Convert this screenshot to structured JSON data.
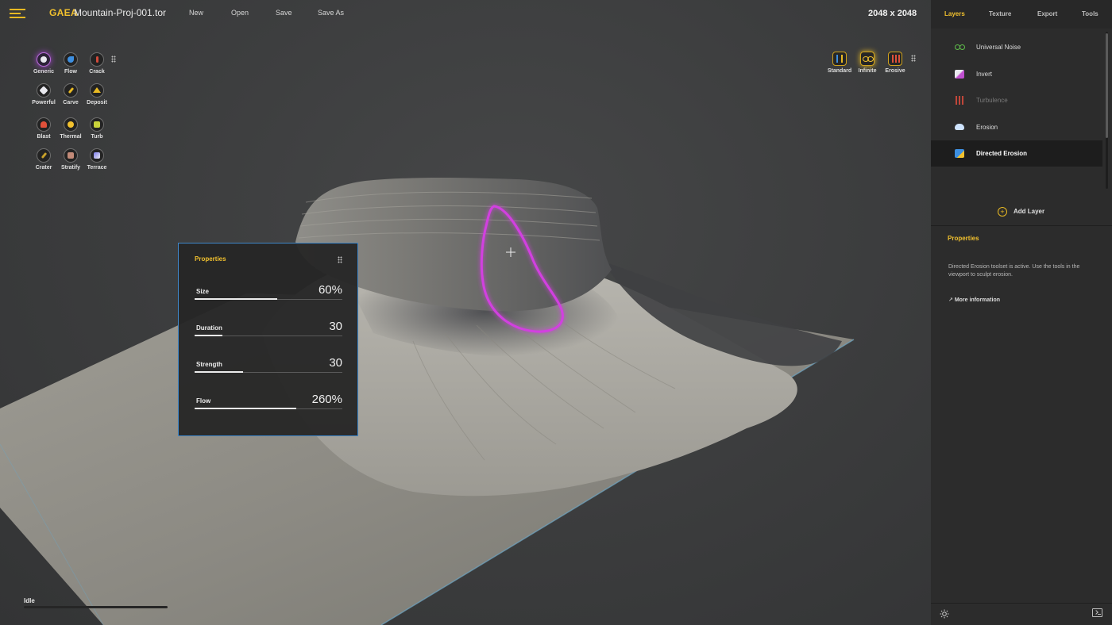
{
  "header": {
    "brand": "GAEA",
    "project": "Mountain-Proj-001.tor",
    "actions": [
      "New",
      "Open",
      "Save",
      "Save As"
    ],
    "resolution": "2048 x 2048"
  },
  "tools": {
    "active": "Generic",
    "items": [
      {
        "label": "Generic",
        "icon": "generic-icon"
      },
      {
        "label": "Flow",
        "icon": "flow-icon"
      },
      {
        "label": "Crack",
        "icon": "crack-icon"
      },
      {
        "label": "Powerful",
        "icon": "powerful-icon"
      },
      {
        "label": "Carve",
        "icon": "carve-icon"
      },
      {
        "label": "Deposit",
        "icon": "deposit-icon"
      },
      {
        "label": "Blast",
        "icon": "blast-icon"
      },
      {
        "label": "Thermal",
        "icon": "thermal-icon"
      },
      {
        "label": "Turb",
        "icon": "turb-icon"
      },
      {
        "label": "Crater",
        "icon": "crater-icon"
      },
      {
        "label": "Stratify",
        "icon": "stratify-icon"
      },
      {
        "label": "Terrace",
        "icon": "terrace-icon"
      }
    ]
  },
  "modes": {
    "active": "Infinite",
    "items": [
      {
        "label": "Standard",
        "icon": "standard-icon"
      },
      {
        "label": "Infinite",
        "icon": "infinity-icon"
      },
      {
        "label": "Erosive",
        "icon": "erosive-icon"
      }
    ]
  },
  "properties_panel": {
    "title": "Properties",
    "rows": [
      {
        "label": "Size",
        "value": "60%",
        "level": 0.56
      },
      {
        "label": "Duration",
        "value": "30",
        "level": 0.19
      },
      {
        "label": "Strength",
        "value": "30",
        "level": 0.33
      },
      {
        "label": "Flow",
        "value": "260%",
        "level": 0.69
      }
    ]
  },
  "status": {
    "text": "Idle"
  },
  "sidebar": {
    "tabs": [
      "Layers",
      "Texture",
      "Export",
      "Tools"
    ],
    "active_tab": "Layers",
    "layers": [
      {
        "name": "Universal Noise",
        "icon": "infinity-icon",
        "state": "normal"
      },
      {
        "name": "Invert",
        "icon": "invert-icon",
        "state": "normal"
      },
      {
        "name": "Turbulence",
        "icon": "turbulence-icon",
        "state": "disabled"
      },
      {
        "name": "Erosion",
        "icon": "cloud-icon",
        "state": "normal"
      },
      {
        "name": "Directed Erosion",
        "icon": "directed-erosion-icon",
        "state": "selected"
      }
    ],
    "add_layer": "Add Layer",
    "properties_title": "Properties",
    "properties_desc": "Directed Erosion toolset is active. Use the tools in the viewport to sculpt erosion.",
    "more_info": "More information"
  },
  "colors": {
    "accent": "#f2c12e",
    "selection_glow": "#d23fe0",
    "panel_border": "#3f87c9"
  }
}
